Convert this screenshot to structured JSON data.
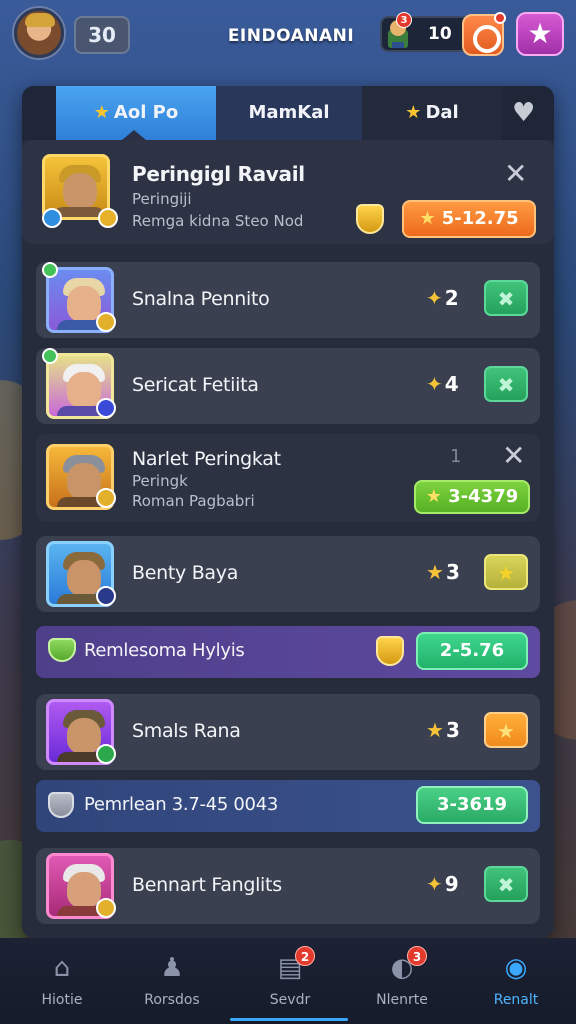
{
  "topbar": {
    "level": "30",
    "title": "EINDOANANI",
    "resource_value": "10",
    "resource_badge": "3"
  },
  "tabs": [
    {
      "label": "Aol Po",
      "icon": "star-icon",
      "active": true
    },
    {
      "label": "MamKal",
      "icon": "",
      "active": false
    },
    {
      "label": "Dal",
      "icon": "star-icon",
      "active": false
    }
  ],
  "header_card": {
    "name": "Peringigl Ravail",
    "sub1": "Peringiji",
    "sub2": "Remga kidna Steo Nod",
    "reward": "5-12.75"
  },
  "rows": [
    {
      "name": "Snalna Pennito",
      "count": "2",
      "action": "check"
    },
    {
      "name": "Sericat Fetiita",
      "count": "4",
      "action": "check"
    },
    {
      "name": "Narlet Peringkat",
      "sub1": "Peringk",
      "sub2": "Roman Pagbabri",
      "count": "1",
      "reward": "3-4379"
    },
    {
      "name": "Benty Baya",
      "count": "3",
      "action": "star"
    },
    {
      "name": "Smals Rana",
      "count": "3",
      "action": "star"
    },
    {
      "name": "Bennart Fanglits",
      "count": "9",
      "action": "check"
    }
  ],
  "strips": [
    {
      "label": "Remlesoma Hylyis",
      "value": "2-5.76"
    },
    {
      "label": "Pemrlean  3.7-45 0043",
      "value": "3-3619"
    }
  ],
  "bottom_nav": [
    {
      "label": "Hiotie",
      "icon": "home-icon",
      "badge": ""
    },
    {
      "label": "Rorsdos",
      "icon": "bell-icon",
      "badge": ""
    },
    {
      "label": "Sevdr",
      "icon": "inbox-icon",
      "badge": "2"
    },
    {
      "label": "Nlenrte",
      "icon": "chat-icon",
      "badge": "3"
    },
    {
      "label": "Renalt",
      "icon": "search-icon",
      "badge": ""
    }
  ],
  "colors": {
    "accent_blue": "#3aa8ff",
    "panel": "#262c3c",
    "gold": "#f6c338"
  }
}
